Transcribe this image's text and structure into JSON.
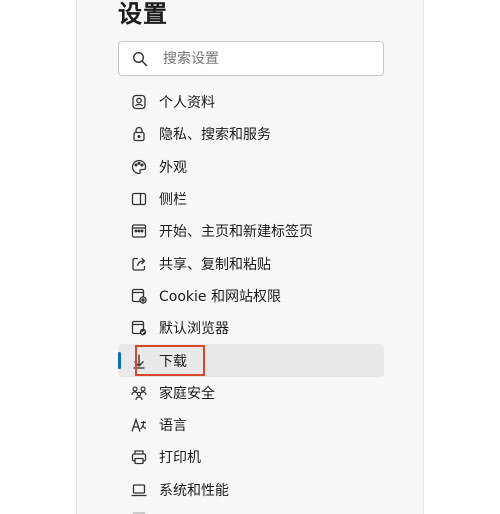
{
  "page": {
    "title": "设置",
    "search": {
      "placeholder": "搜索设置",
      "value": ""
    }
  },
  "nav": {
    "items": [
      {
        "label": "个人资料",
        "icon": "profile-icon"
      },
      {
        "label": "隐私、搜索和服务",
        "icon": "lock-icon"
      },
      {
        "label": "外观",
        "icon": "palette-icon"
      },
      {
        "label": "侧栏",
        "icon": "sidebar-icon"
      },
      {
        "label": "开始、主页和新建标签页",
        "icon": "home-page-icon"
      },
      {
        "label": "共享、复制和粘贴",
        "icon": "share-icon"
      },
      {
        "label": "Cookie 和网站权限",
        "icon": "cookie-settings-icon"
      },
      {
        "label": "默认浏览器",
        "icon": "browser-check-icon"
      },
      {
        "label": "下载",
        "icon": "download-icon",
        "selected": true
      },
      {
        "label": "家庭安全",
        "icon": "family-icon"
      },
      {
        "label": "语言",
        "icon": "language-icon"
      },
      {
        "label": "打印机",
        "icon": "printer-icon"
      },
      {
        "label": "系统和性能",
        "icon": "laptop-icon"
      }
    ]
  },
  "colors": {
    "accent": "#0f6cbd",
    "highlight_box": "#d9472b",
    "selected_bg": "#e9e9e9",
    "panel_bg": "#f7f7f7"
  }
}
